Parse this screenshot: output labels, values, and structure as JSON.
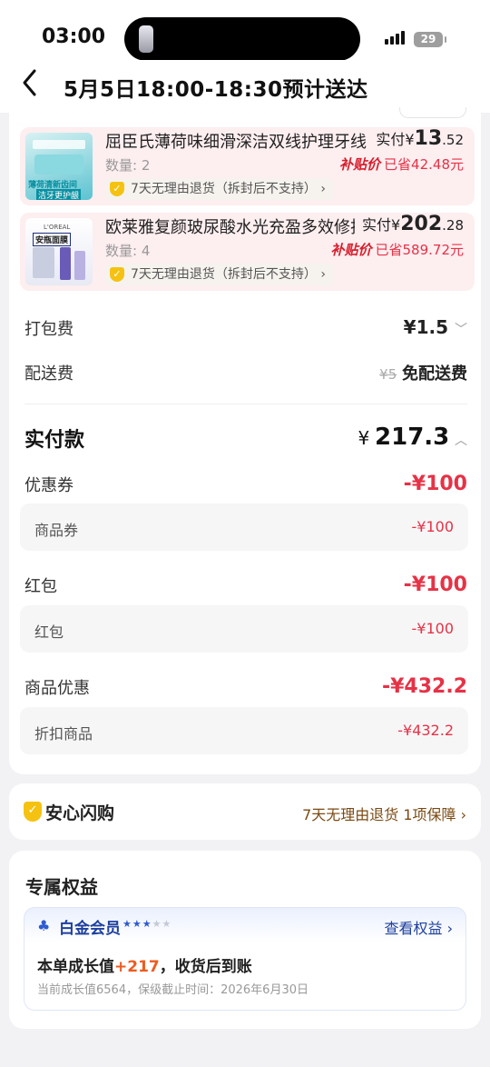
{
  "status_bar": {
    "time": "03:00",
    "battery": "29"
  },
  "nav": {
    "back_icon": "chevron-left-icon",
    "title": "5月5日18:00-18:30预计送达"
  },
  "items": [
    {
      "name": "屈臣氏薄荷味细滑深洁双线护理牙线",
      "qty": "数量: 2",
      "tag": "7天无理由退货（拆封后不支持）",
      "paid_label": "实付",
      "currency": "¥",
      "price_int": "13",
      "price_dec": ".52",
      "subsidy_logo": "补贴价",
      "saved": "已省42.48元",
      "thumb_text_1": "薄荷清新齿间",
      "thumb_text_2": "洁牙更护龈"
    },
    {
      "name": "欧莱雅复颜玻尿酸水光充盈多效修护",
      "qty": "数量: 4",
      "tag": "7天无理由退货（拆封后不支持）",
      "paid_label": "实付",
      "currency": "¥",
      "price_int": "202",
      "price_dec": ".28",
      "subsidy_logo": "补贴价",
      "saved": "已省589.72元",
      "thumb_text_1": "L'OREAL",
      "thumb_text_2": "安瓶面膜"
    }
  ],
  "fees": {
    "packing_label": "打包费",
    "packing_value": "¥1.5",
    "delivery_label": "配送费",
    "delivery_original": "¥5",
    "delivery_value": "免配送费"
  },
  "total": {
    "label": "实付款",
    "currency": "¥",
    "value": "217.3"
  },
  "discounts": [
    {
      "label": "优惠券",
      "value": "-¥100",
      "sub_label": "商品券",
      "sub_value": "-¥100"
    },
    {
      "label": "红包",
      "value": "-¥100",
      "sub_label": "红包",
      "sub_value": "-¥100"
    },
    {
      "label": "商品优惠",
      "value": "-¥432.2",
      "sub_label": "折扣商品",
      "sub_value": "-¥432.2"
    }
  ],
  "assurance": {
    "title": "安心闪购",
    "detail": "7天无理由退货 1项保障"
  },
  "benefits": {
    "title": "专属权益",
    "member_level": "白金会员",
    "stars_filled": 3,
    "stars_total": 5,
    "view_link": "查看权益",
    "growth_prefix": "本单成长值",
    "growth_value": "+217",
    "growth_suffix": "，收货后到账",
    "note": "当前成长值6564，保级截止时间：2026年6月30日"
  },
  "colors": {
    "accent_red": "#e63246",
    "gold": "#f5c211",
    "price_dark": "#222222",
    "member_blue": "#2f5bd0"
  }
}
